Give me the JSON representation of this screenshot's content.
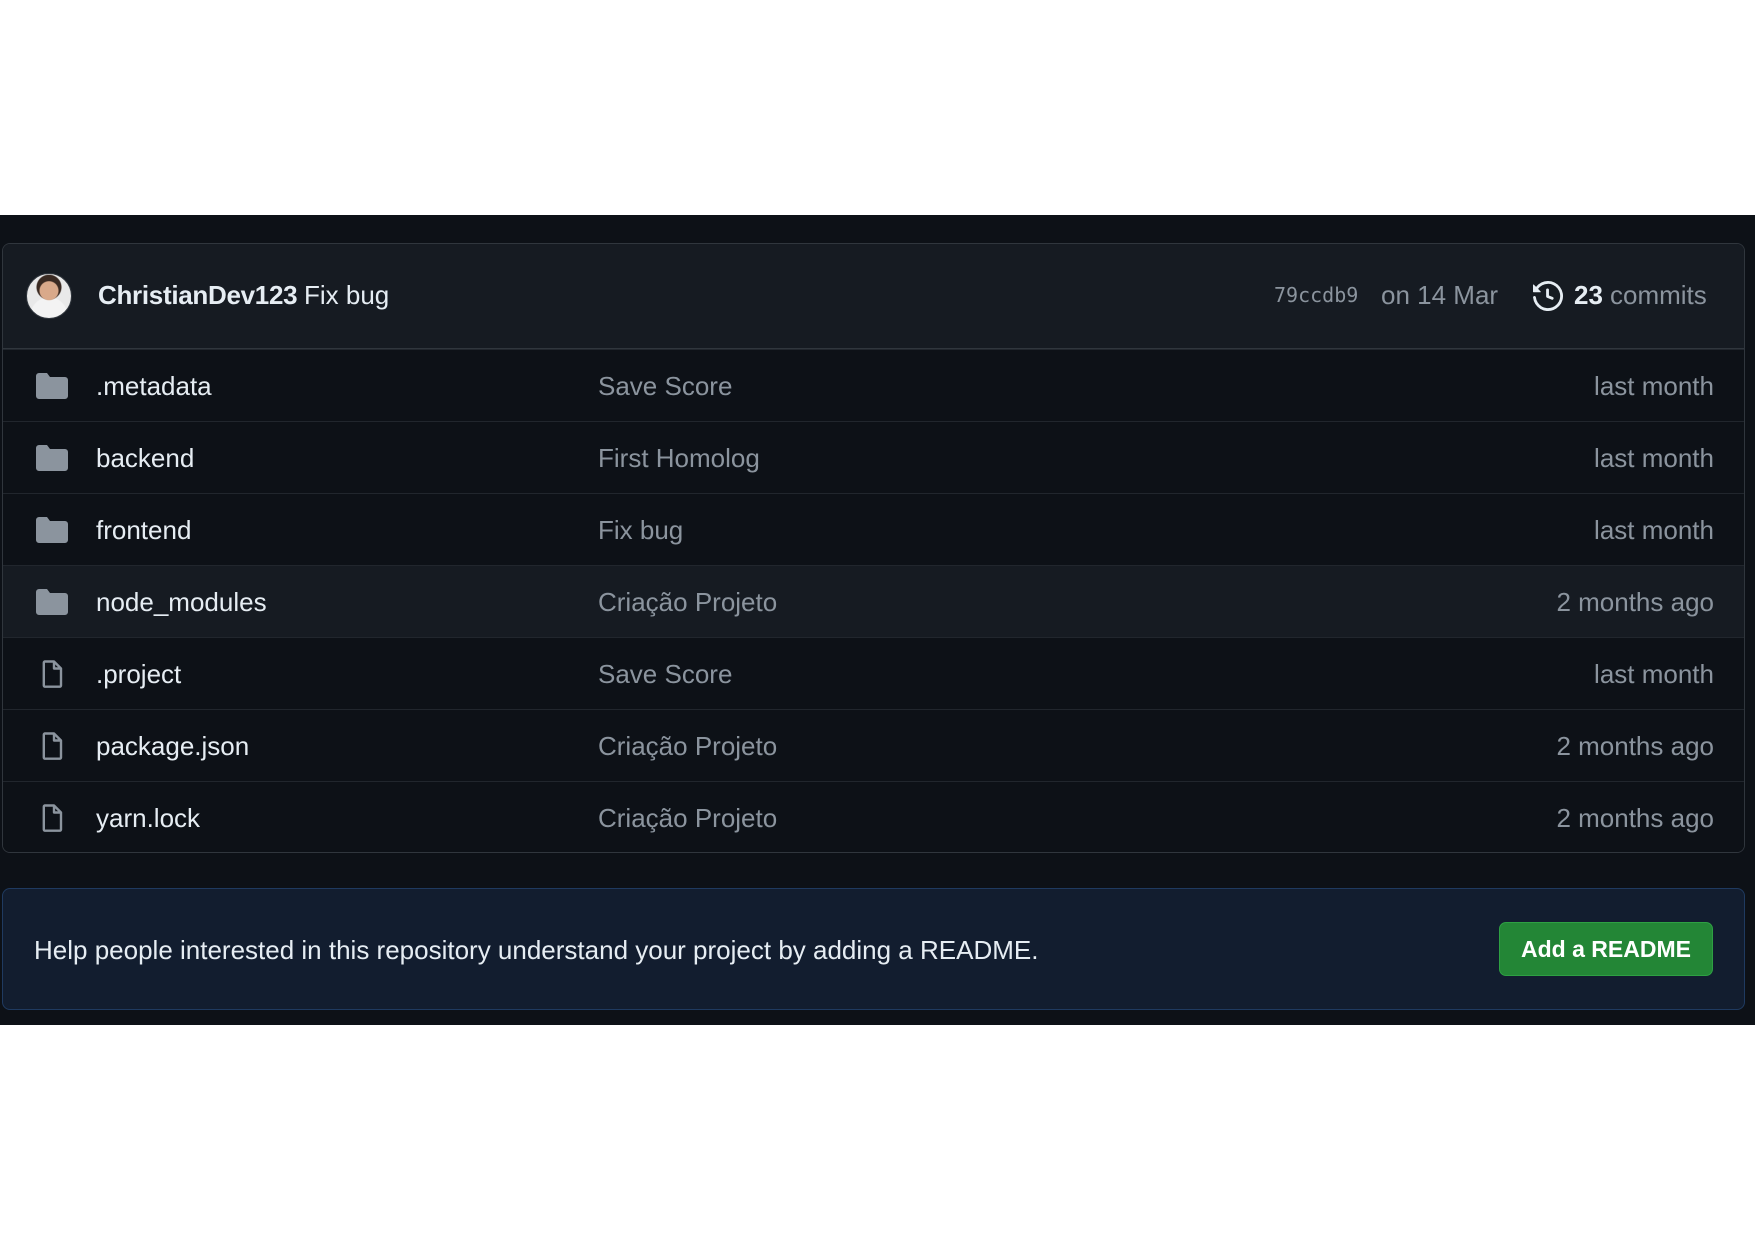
{
  "latest_commit": {
    "author": "ChristianDev123",
    "message": "Fix bug",
    "hash": "79ccdb9",
    "date": "on 14 Mar",
    "commit_count": "23",
    "commit_count_label": "commits"
  },
  "files": [
    {
      "type": "folder",
      "name": ".metadata",
      "message": "Save Score",
      "age": "last month"
    },
    {
      "type": "folder",
      "name": "backend",
      "message": "First Homolog",
      "age": "last month"
    },
    {
      "type": "folder",
      "name": "frontend",
      "message": "Fix bug",
      "age": "last month"
    },
    {
      "type": "folder",
      "name": "node_modules",
      "message": "Criação Projeto",
      "age": "2 months ago"
    },
    {
      "type": "file",
      "name": ".project",
      "message": "Save Score",
      "age": "last month"
    },
    {
      "type": "file",
      "name": "package.json",
      "message": "Criação Projeto",
      "age": "2 months ago"
    },
    {
      "type": "file",
      "name": "yarn.lock",
      "message": "Criação Projeto",
      "age": "2 months ago"
    }
  ],
  "readme_banner": {
    "text": "Help people interested in this repository understand your project by adding a README.",
    "button_label": "Add a README"
  },
  "colors": {
    "background": "#0d1117",
    "header": "#161b22",
    "text": "#e6edf3",
    "muted": "#8b949e",
    "accent_button": "#238636"
  }
}
